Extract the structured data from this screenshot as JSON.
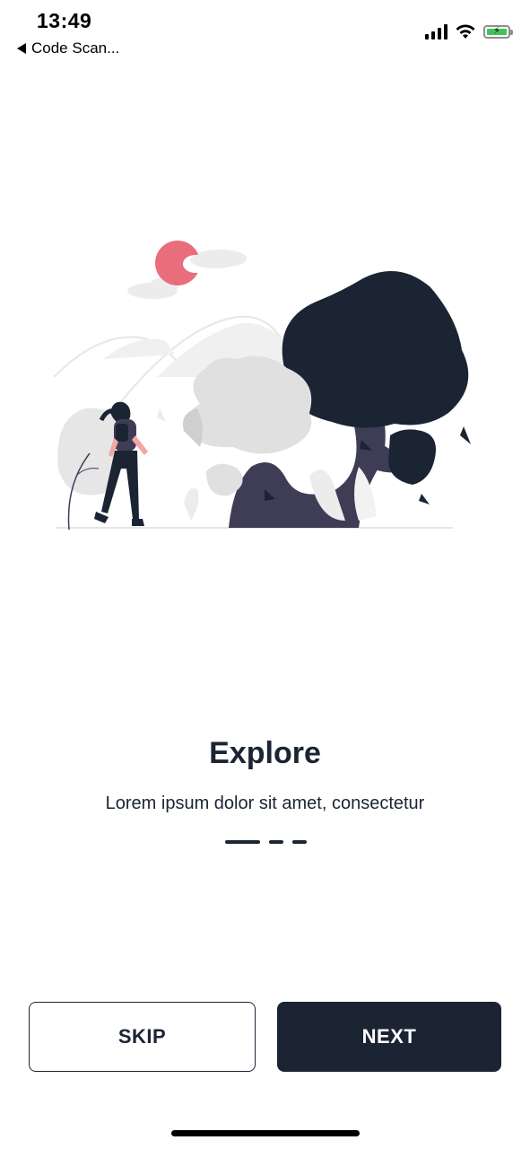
{
  "status_bar": {
    "time": "13:49",
    "back_app": "Code Scan...",
    "icons": [
      "signal-icon",
      "wifi-icon",
      "battery-charging-icon"
    ]
  },
  "onboarding": {
    "title": "Explore",
    "subtitle": "Lorem ipsum dolor sit amet, consectetur",
    "page_indicator": {
      "current": 1,
      "total": 3
    }
  },
  "actions": {
    "skip_label": "SKIP",
    "next_label": "NEXT"
  },
  "colors": {
    "primary": "#1b2433",
    "sun": "#e96d7b",
    "tree_trunk": "#3f3d56",
    "battery": "#43c25a"
  }
}
